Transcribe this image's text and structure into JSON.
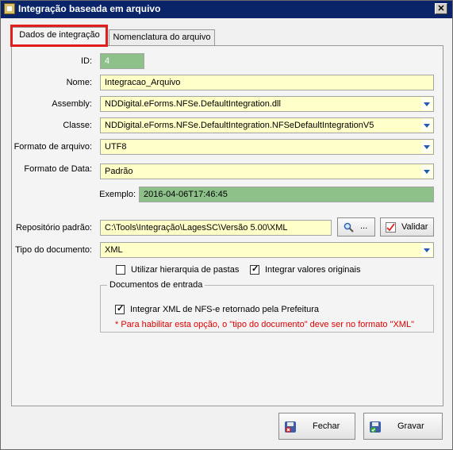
{
  "window": {
    "title": "Integração baseada em arquivo",
    "close_glyph": "✕"
  },
  "tabs": [
    {
      "label": "Dados de integração",
      "active": true
    },
    {
      "label": "Nomenclatura do arquivo",
      "active": false
    }
  ],
  "form": {
    "id": {
      "label": "ID:",
      "value": "4"
    },
    "nome": {
      "label": "Nome:",
      "value": "Integracao_Arquivo"
    },
    "assembly": {
      "label": "Assembly:",
      "value": "NDDigital.eForms.NFSe.DefaultIntegration.dll"
    },
    "classe": {
      "label": "Classe:",
      "value": "NDDigital.eForms.NFSe.DefaultIntegration.NFSeDefaultIntegrationV5"
    },
    "formato_arquivo": {
      "label": "Formato de arquivo:",
      "value": "UTF8"
    },
    "formato_data": {
      "label": "Formato de Data:",
      "value": "Padrão"
    },
    "exemplo": {
      "label": "Exemplo:",
      "value": "2016-04-06T17:46:45"
    },
    "repositorio": {
      "label": "Repositório padrão:",
      "value": "C:\\Tools\\Integração\\LagesSC\\Versão 5.00\\XML",
      "browse_label": "...",
      "validate_label": "Validar"
    },
    "tipo_documento": {
      "label": "Tipo do documento:",
      "value": "XML"
    },
    "hierarquia": {
      "label": "Utilizar hierarquia de pastas",
      "checked": false
    },
    "valores_originais": {
      "label": "Integrar valores originais",
      "checked": true
    }
  },
  "documentos_entrada": {
    "title": "Documentos de entrada",
    "integrar_xml": {
      "label": "Integrar XML de NFS-e retornado pela Prefeitura",
      "checked": true
    },
    "warning": "* Para habilitar esta opção, o \"tipo do documento\" deve ser no formato \"XML\""
  },
  "footer": {
    "close_label": "Fechar",
    "save_label": "Gravar"
  },
  "colors": {
    "highlight": "#e11d1d",
    "readonly_field": "#8dc189",
    "editable_field": "#ffffc8",
    "warning_text": "#e00000"
  }
}
